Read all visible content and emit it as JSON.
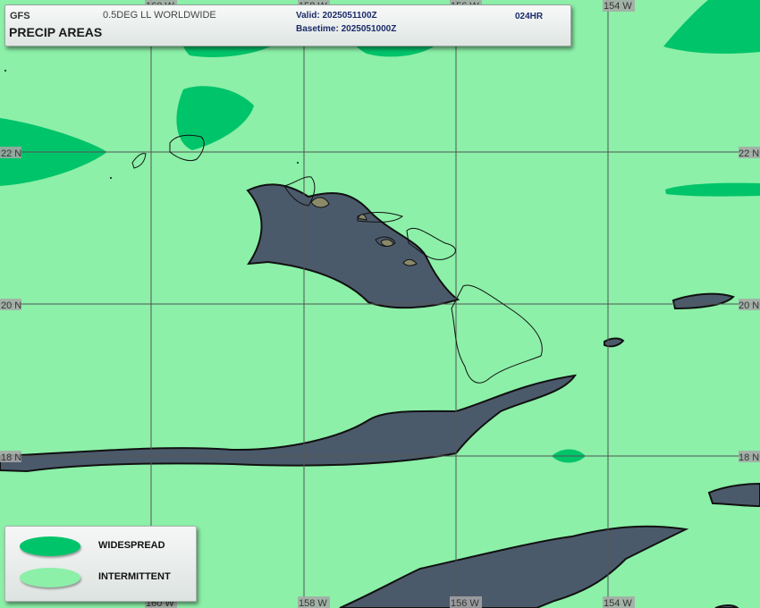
{
  "header": {
    "model": "GFS",
    "product_title": "PRECIP AREAS",
    "grid": "0.5DEG LL WORLDWIDE",
    "valid": "Valid: 2025051100Z",
    "basetime": "Basetime: 2025051000Z",
    "forecast_hour": "024HR"
  },
  "legend": {
    "items": [
      {
        "label": "WIDESPREAD",
        "color": "#00c46a"
      },
      {
        "label": "INTERMITTENT",
        "color": "#8cf0a8"
      }
    ]
  },
  "map_labels": {
    "lat_22": "22 N",
    "lat_20": "20 N",
    "lat_18": "18 N",
    "lon_160": "160 W",
    "lon_158": "158 W",
    "lon_156": "156 W",
    "lon_154": "154 W"
  },
  "colors": {
    "intermittent": "#8cf0a8",
    "widespread": "#00c46a",
    "heavy_area": "#4b5a6b",
    "land": "#8a8a6a",
    "gridline": "#555555"
  }
}
